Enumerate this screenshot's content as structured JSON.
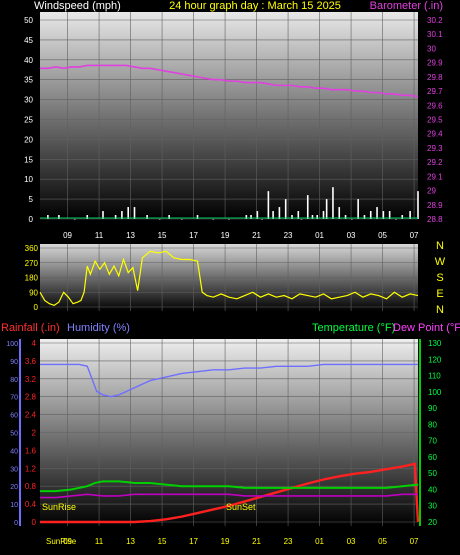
{
  "header": {
    "left": "Windspeed (mph)",
    "center": "24 hour graph day : March 15 2025",
    "right": "Barometer (.in)"
  },
  "colors": {
    "wind": "#ffffff",
    "wind_gust": "#dddddd",
    "baro": "#e040e0",
    "dir": "#ffff00",
    "rain": "#ff2020",
    "humidity": "#6f6fff",
    "temp": "#00d000",
    "dew": "#c000c0",
    "grid": "#606060",
    "sun_label": "#ffff00",
    "rain_label": "#ff3030",
    "hum_label": "#8080ff",
    "temp_label": "#00ff40",
    "dew_label": "#ff40ff"
  },
  "x_ticks": [
    "09",
    "11",
    "13",
    "15",
    "17",
    "19",
    "21",
    "23",
    "01",
    "03",
    "05",
    "07"
  ],
  "chart_data": [
    {
      "type": "line",
      "title": "24 hour graph day : March 15 2025",
      "panel": "wind-baro",
      "ylabel_left": "Windspeed (mph)",
      "ylabel_right": "Barometer (.in)",
      "yleft_ticks": [
        "0",
        "5",
        "10",
        "15",
        "20",
        "25",
        "30",
        "35",
        "40",
        "45",
        "50"
      ],
      "yleft_range": [
        0,
        50
      ],
      "yright_ticks": [
        "28.8",
        "28.9",
        "29",
        "29.1",
        "29.2",
        "29.3",
        "29.4",
        "29.5",
        "29.6",
        "29.7",
        "29.8",
        "29.9",
        "30",
        "30.1",
        "30.2"
      ],
      "yright_range": [
        28.8,
        30.2
      ],
      "series": [
        {
          "name": "Barometer (.in)",
          "axis": "right",
          "x": [
            0,
            0.5,
            1,
            1.5,
            2,
            2.5,
            3,
            3.5,
            4,
            4.5,
            5,
            5.5,
            6,
            6.5,
            7,
            7.5,
            8,
            8.5,
            9,
            9.5,
            10,
            10.5,
            11,
            11.5,
            12,
            12.5,
            13,
            13.5,
            14,
            14.5,
            15,
            15.5,
            16,
            16.5,
            17,
            17.5,
            18,
            18.5,
            19,
            19.5,
            20,
            20.5,
            21,
            21.5,
            22,
            22.5,
            23,
            23.5,
            24
          ],
          "values": [
            29.86,
            29.86,
            29.87,
            29.86,
            29.87,
            29.87,
            29.88,
            29.88,
            29.88,
            29.88,
            29.88,
            29.88,
            29.87,
            29.86,
            29.86,
            29.85,
            29.84,
            29.83,
            29.82,
            29.81,
            29.8,
            29.79,
            29.78,
            29.78,
            29.77,
            29.77,
            29.76,
            29.76,
            29.76,
            29.75,
            29.74,
            29.74,
            29.74,
            29.73,
            29.73,
            29.72,
            29.72,
            29.71,
            29.71,
            29.71,
            29.7,
            29.7,
            29.69,
            29.69,
            29.68,
            29.68,
            29.67,
            29.67,
            29.66
          ]
        },
        {
          "name": "Windspeed (mph)",
          "axis": "left",
          "x": [
            0.5,
            1.2,
            2.2,
            3.0,
            4.0,
            4.8,
            5.2,
            5.6,
            6.0,
            6.8,
            7.6,
            8.2,
            9.0,
            10.0,
            11.0,
            12.0,
            13.1,
            13.4,
            13.8,
            14.1,
            14.5,
            14.8,
            15.2,
            15.6,
            16.0,
            16.4,
            16.6,
            17.0,
            17.3,
            17.6,
            18.0,
            18.2,
            18.6,
            19.0,
            19.4,
            19.8,
            20.2,
            20.6,
            21.0,
            21.4,
            21.8,
            22.2,
            22.6,
            23.0,
            23.5,
            24
          ],
          "values": [
            1,
            1,
            0,
            1,
            2,
            1,
            2,
            3,
            3,
            1,
            0,
            1,
            0,
            1,
            0,
            0,
            1,
            1,
            2,
            0,
            7,
            2,
            3,
            5,
            1,
            2,
            0,
            6,
            1,
            1,
            2,
            5,
            8,
            3,
            1,
            0,
            5,
            1,
            2,
            3,
            2,
            2,
            0,
            1,
            2,
            7
          ]
        }
      ]
    },
    {
      "type": "line",
      "panel": "direction",
      "yleft_ticks": [
        "0",
        "90",
        "180",
        "270",
        "360"
      ],
      "yleft_range": [
        0,
        360
      ],
      "right_labels": [
        "N",
        "W",
        "S",
        "E",
        "N"
      ],
      "series": [
        {
          "name": "Wind Direction",
          "x": [
            0,
            0.3,
            0.6,
            0.9,
            1.2,
            1.5,
            1.8,
            2.1,
            2.4,
            2.6,
            2.8,
            3.0,
            3.2,
            3.5,
            3.8,
            4.1,
            4.4,
            4.7,
            5.0,
            5.3,
            5.6,
            5.9,
            6.2,
            6.5,
            7.0,
            7.5,
            8.0,
            8.5,
            9.0,
            9.5,
            10.0,
            10.3,
            10.6,
            11.0,
            11.5,
            12.0,
            12.5,
            13.0,
            13.5,
            14.0,
            14.5,
            15.0,
            15.5,
            16.0,
            16.5,
            17.0,
            17.5,
            18.0,
            18.5,
            19.0,
            19.5,
            20.0,
            20.5,
            21.0,
            21.5,
            22.0,
            22.5,
            23.0,
            23.5,
            24
          ],
          "values": [
            90,
            40,
            20,
            10,
            30,
            90,
            60,
            20,
            30,
            40,
            90,
            250,
            200,
            280,
            230,
            270,
            200,
            250,
            190,
            290,
            210,
            240,
            100,
            300,
            340,
            330,
            340,
            300,
            290,
            290,
            280,
            90,
            70,
            60,
            80,
            60,
            50,
            70,
            90,
            60,
            80,
            60,
            70,
            50,
            80,
            70,
            60,
            80,
            50,
            60,
            70,
            90,
            60,
            80,
            70,
            50,
            90,
            60,
            80,
            70
          ]
        }
      ]
    },
    {
      "type": "line",
      "panel": "rain-humidity-temp",
      "ylabel_left": "Rainfall (.in)",
      "ylabel_left2": "Humidity (%)",
      "ylabel_right": "Temperature (°F)",
      "ylabel_right2": "Dew Point (°F)",
      "rain_ticks": [
        "0",
        "0.4",
        "0.8",
        "1.2",
        "1.6",
        "2",
        "2.4",
        "2.8",
        "3.2",
        "3.6",
        "4"
      ],
      "rain_range": [
        0,
        4
      ],
      "humidity_ticks": [
        "0",
        "10",
        "20",
        "30",
        "40",
        "50",
        "60",
        "70",
        "80",
        "90",
        "100"
      ],
      "humidity_range": [
        0,
        100
      ],
      "temp_ticks": [
        "20",
        "30",
        "40",
        "50",
        "60",
        "70",
        "80",
        "90",
        "100",
        "110",
        "120",
        "130"
      ],
      "temp_range": [
        20,
        130
      ],
      "annotations": [
        "SunRise",
        "SunSet",
        "SunRise"
      ],
      "series": [
        {
          "name": "Humidity (%)",
          "axis": "humidity",
          "x": [
            0,
            0.5,
            1,
            1.5,
            2,
            2.5,
            3,
            3.3,
            3.6,
            4,
            4.5,
            5,
            5.5,
            6,
            6.5,
            7,
            8,
            9,
            10,
            11,
            12,
            13,
            14,
            15,
            16,
            17,
            18,
            19,
            20,
            21,
            22,
            23,
            24
          ],
          "values": [
            88,
            88,
            88,
            88,
            88,
            88,
            87,
            80,
            73,
            71,
            70,
            71,
            73,
            75,
            77,
            79,
            81,
            83,
            84,
            85,
            85,
            86,
            86,
            87,
            87,
            87,
            88,
            88,
            88,
            88,
            88,
            88,
            88
          ]
        },
        {
          "name": "Rainfall (.in)",
          "axis": "rain",
          "x": [
            0,
            2,
            4,
            6,
            7,
            8,
            9,
            10,
            11,
            12,
            13,
            14,
            15,
            16,
            17,
            18,
            19,
            20,
            21,
            22,
            23,
            23.8,
            24
          ],
          "values": [
            0,
            0,
            0,
            0,
            0.02,
            0.06,
            0.12,
            0.2,
            0.28,
            0.36,
            0.46,
            0.56,
            0.66,
            0.76,
            0.86,
            0.95,
            1.02,
            1.08,
            1.12,
            1.18,
            1.24,
            1.3,
            0
          ]
        },
        {
          "name": "Temperature (°F)",
          "axis": "temp",
          "x": [
            0,
            1,
            2,
            3,
            3.5,
            4,
            5,
            6,
            7,
            8,
            9,
            10,
            11,
            12,
            13,
            14,
            15,
            16,
            17,
            18,
            19,
            20,
            21,
            22,
            23,
            24
          ],
          "values": [
            39,
            39,
            40,
            42,
            44,
            45,
            45,
            44,
            44,
            43,
            42,
            42,
            42,
            42,
            41,
            41,
            41,
            41,
            41,
            41,
            41,
            41,
            41,
            41,
            42,
            43
          ]
        },
        {
          "name": "Dew Point (°F)",
          "axis": "temp",
          "x": [
            0,
            1,
            2,
            3,
            4,
            5,
            6,
            7,
            8,
            9,
            10,
            11,
            12,
            13,
            14,
            15,
            16,
            17,
            18,
            19,
            20,
            21,
            22,
            23,
            24
          ],
          "values": [
            35,
            35,
            36,
            37,
            36,
            36,
            37,
            37,
            37,
            37,
            37,
            37,
            37,
            36,
            36,
            36,
            36,
            36,
            36,
            36,
            36,
            36,
            36,
            37,
            37
          ]
        }
      ]
    }
  ],
  "bottom_labels": [
    "SunRise",
    "09",
    "11",
    "13",
    "15",
    "17",
    "19",
    "21",
    "23",
    "01",
    "03",
    "05",
    "07"
  ]
}
